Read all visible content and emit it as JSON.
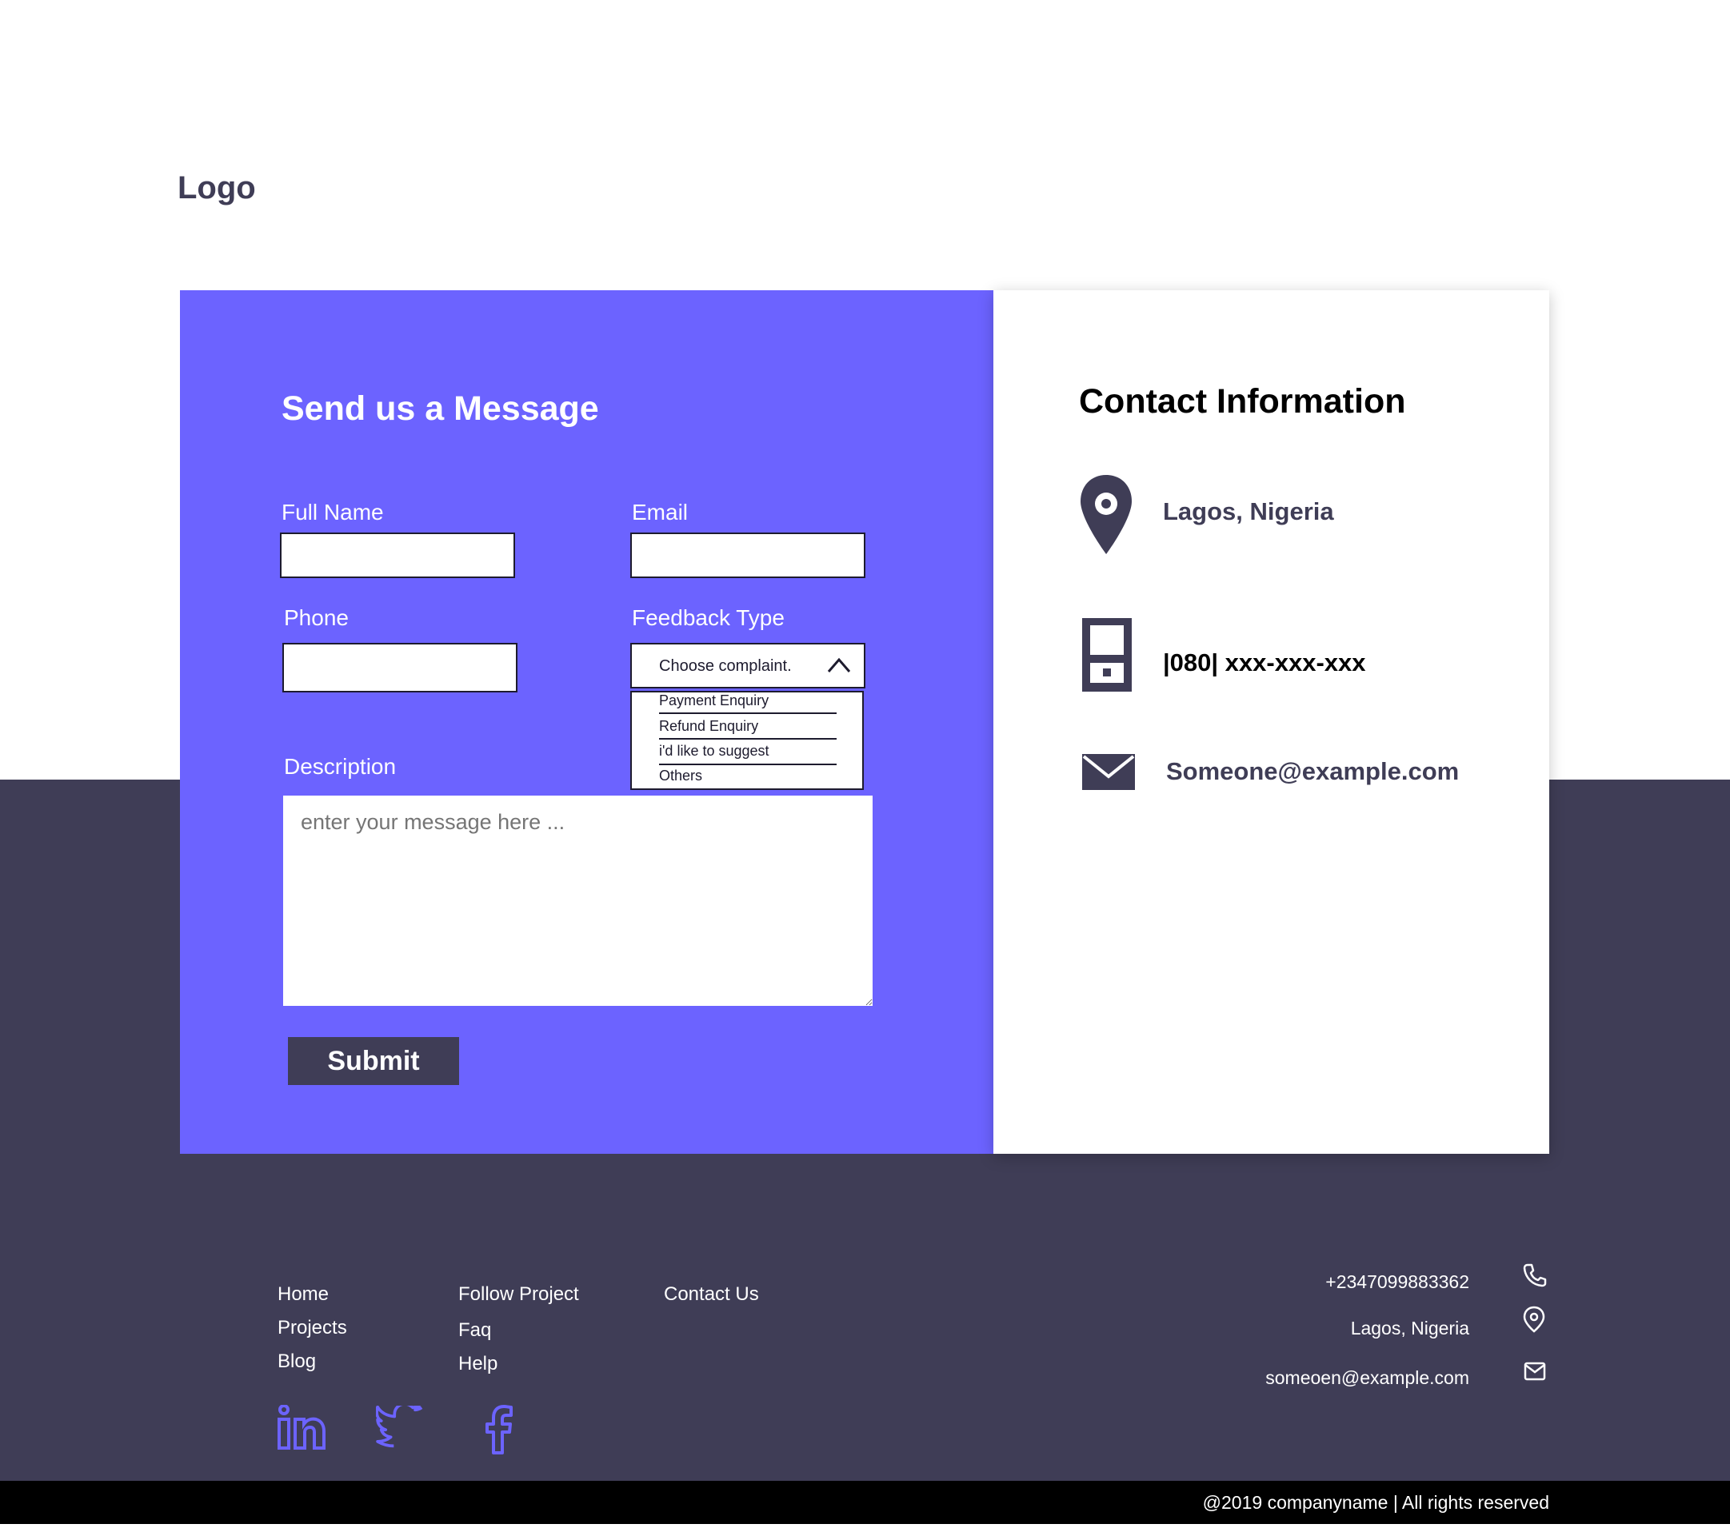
{
  "header": {
    "logo_text": "Logo"
  },
  "form": {
    "title": "Send us a Message",
    "full_name_label": "Full Name",
    "email_label": "Email",
    "phone_label": "Phone",
    "feedback_type_label": "Feedback Type",
    "feedback_type_selected": "Choose complaint.",
    "feedback_options": [
      "Payment Enquiry",
      "Refund Enquiry",
      "i'd like to suggest",
      "Others"
    ],
    "description_label": "Description",
    "description_placeholder": "enter your message here ...",
    "submit_label": "Submit"
  },
  "contact_info": {
    "title": "Contact Information",
    "location": "Lagos, Nigeria",
    "phone": "|080| xxx-xxx-xxx",
    "email": "Someone@example.com"
  },
  "footer": {
    "links_col1": [
      "Home",
      "Projects",
      "Blog"
    ],
    "links_col2": [
      "Follow Project",
      "Faq",
      "Help"
    ],
    "links_col3": [
      "Contact Us"
    ],
    "phone": "+2347099883362",
    "location": "Lagos, Nigeria",
    "email": "someoen@example.com",
    "social_icons": [
      "linkedin-icon",
      "twitter-icon",
      "facebook-icon"
    ],
    "copyright": "@2019 companyname | All rights reserved"
  },
  "colors": {
    "accent": "#6c63ff",
    "dark": "#3f3d56",
    "white": "#ffffff",
    "black": "#000000"
  }
}
